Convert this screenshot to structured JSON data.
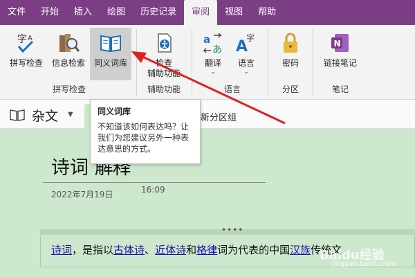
{
  "menu": {
    "items": [
      {
        "label": "文件",
        "name": "menu-file"
      },
      {
        "label": "开始",
        "name": "menu-home"
      },
      {
        "label": "插入",
        "name": "menu-insert"
      },
      {
        "label": "绘图",
        "name": "menu-draw"
      },
      {
        "label": "历史记录",
        "name": "menu-history"
      },
      {
        "label": "审阅",
        "name": "menu-review",
        "active": true
      },
      {
        "label": "视图",
        "name": "menu-view"
      },
      {
        "label": "帮助",
        "name": "menu-help"
      }
    ]
  },
  "ribbon": {
    "spelling": "拼写检查",
    "research": "信息检索",
    "thesaurus": "同义词库",
    "check_line1": "检查",
    "check_line2": "辅助功能",
    "translate": "翻译",
    "language": "语言",
    "password": "密码",
    "linked_notes": "链接笔记",
    "groups": {
      "proofing": "拼写检查",
      "accessibility": "辅助功能",
      "language": "语言",
      "section": "分区",
      "notes": "笔记"
    },
    "caret": "⌄"
  },
  "notebook": {
    "name": "杂文",
    "new_section_group": "新分区组"
  },
  "tooltip": {
    "title": "同义词库",
    "body": "不知道该如何表达吗？让我们为您建议另外一种表达意思的方式。"
  },
  "page": {
    "title_main": "诗词",
    "title_cut": "解释",
    "date": "2022年7月19日",
    "time": "16:09",
    "handle": "••••",
    "body": {
      "link1": "诗词",
      "t1": "，是指以",
      "link2": "古体诗",
      "t2": "、",
      "link3": "近体诗",
      "t3": "和",
      "link4": "格律",
      "t4": "词为代表的中国",
      "link5": "汉族",
      "t5": "传统文"
    },
    "watermark": "Baidu经验",
    "watermark_sub": "jingyan.baidu.com"
  },
  "colors": {
    "accent": "#7b3e84",
    "page_bg": "#cde8cd",
    "arrow": "#e02020"
  }
}
